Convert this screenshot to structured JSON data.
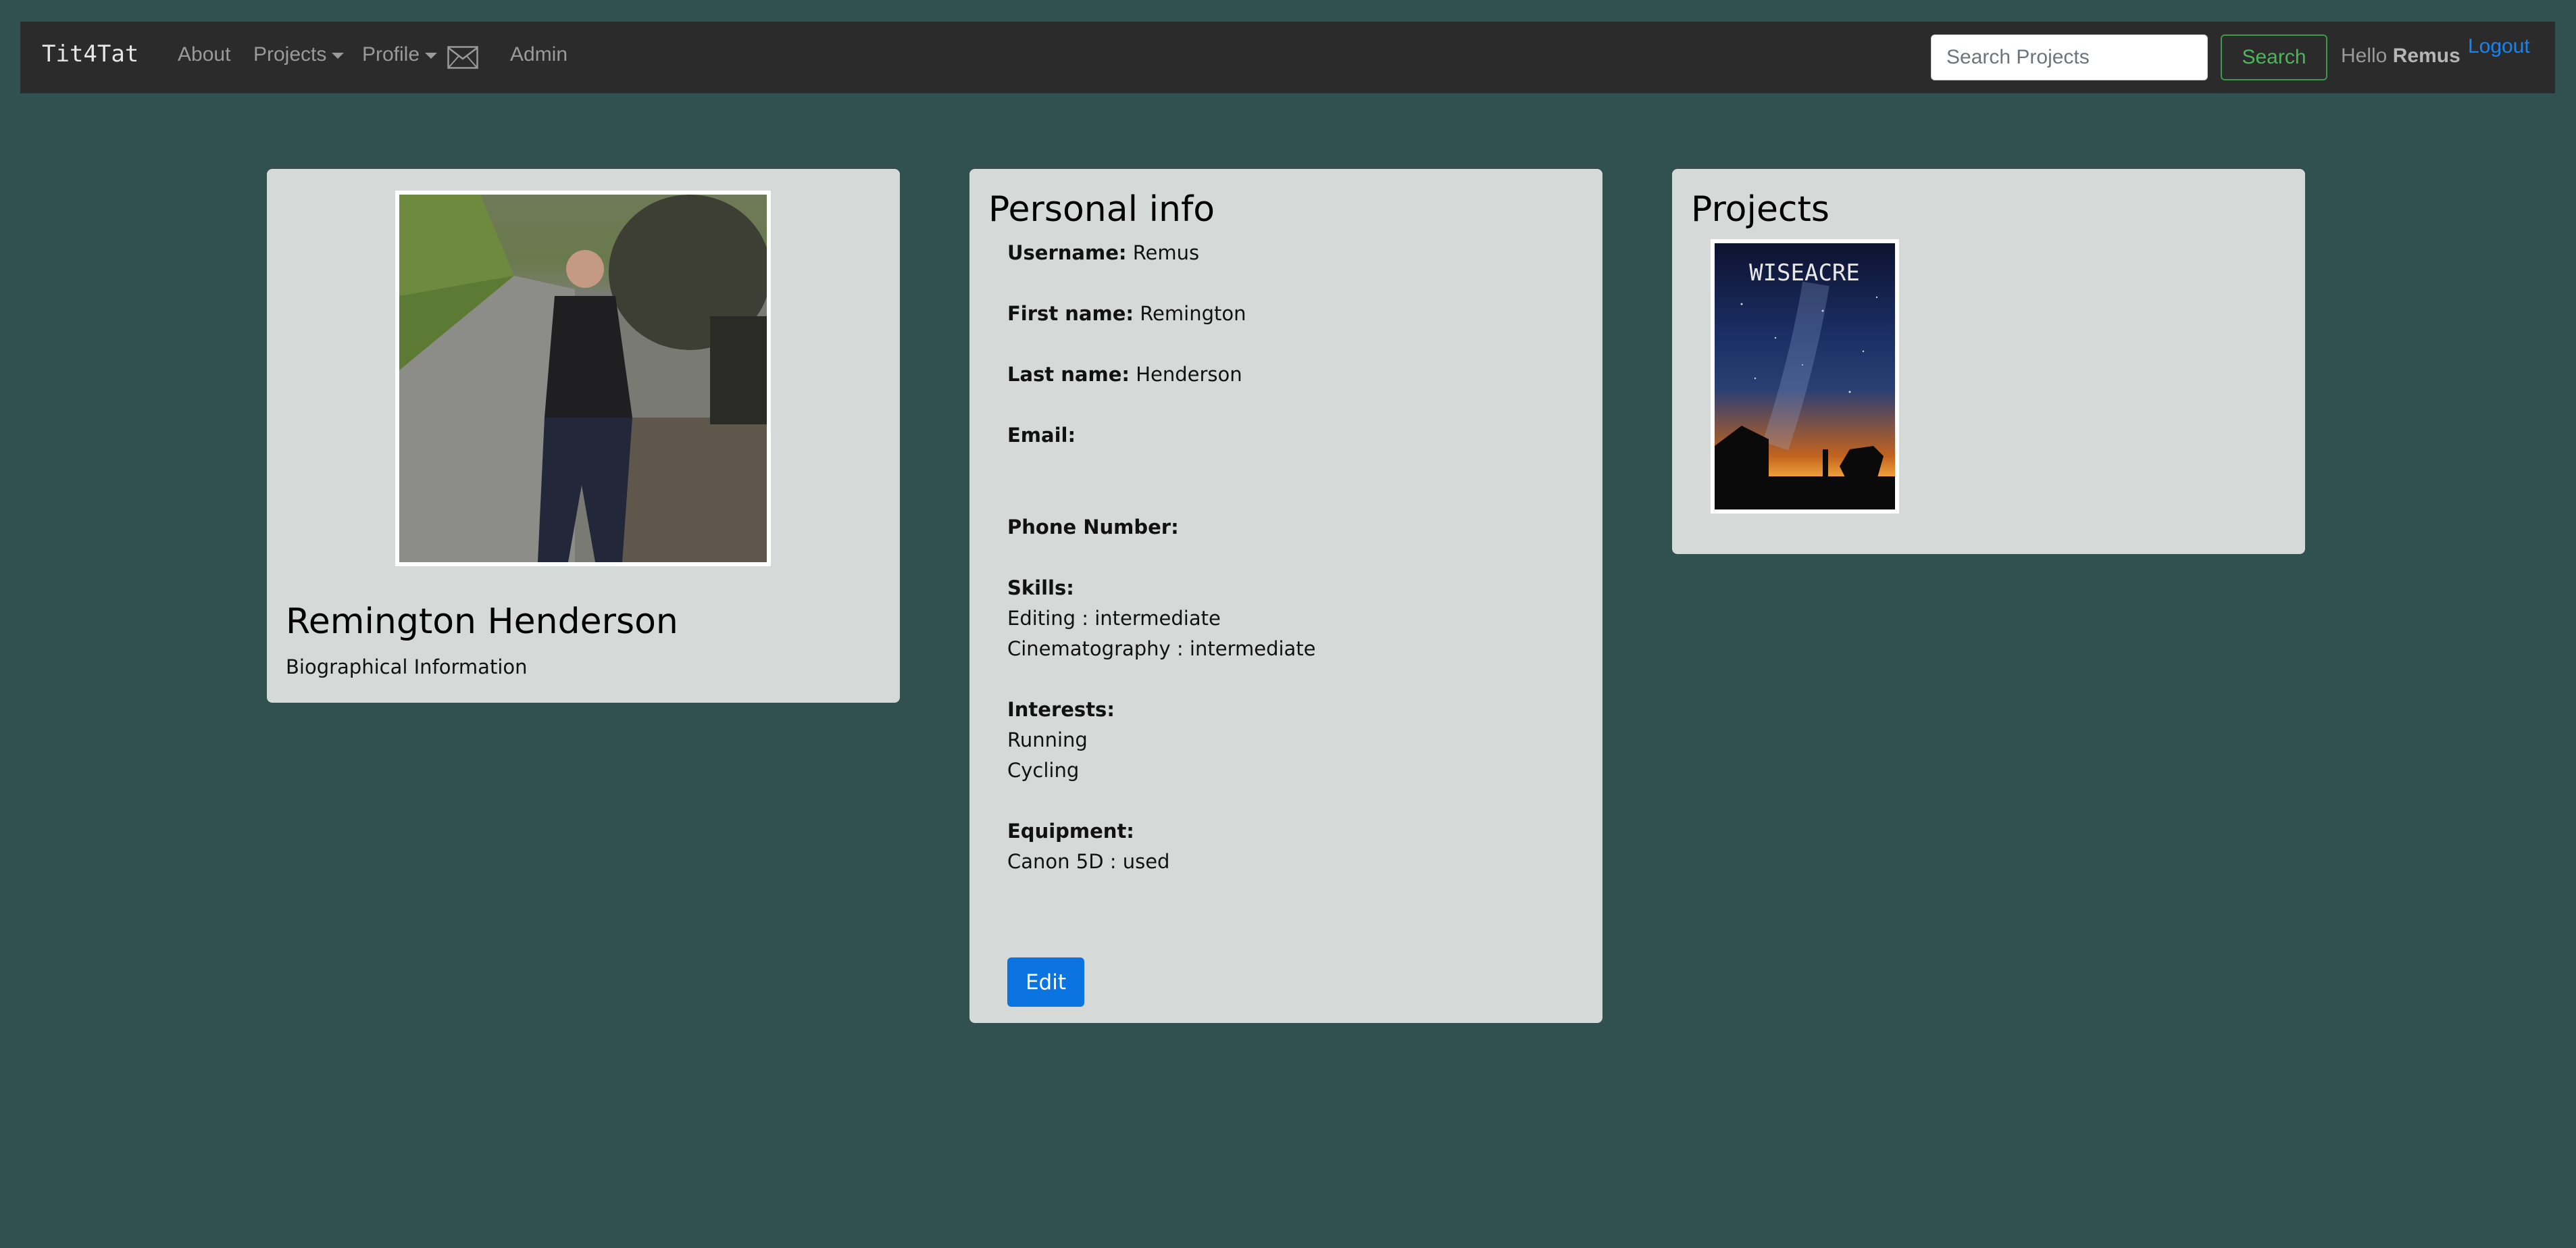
{
  "nav": {
    "brand": "Tit4Tat",
    "about": "About",
    "projects": "Projects",
    "profile": "Profile",
    "admin": "Admin",
    "search_placeholder": "Search Projects",
    "search_button": "Search",
    "hello": "Hello",
    "username": "Remus",
    "logout": "Logout"
  },
  "profile_card": {
    "name": "Remington Henderson",
    "bio": "Biographical Information"
  },
  "personal_info": {
    "title": "Personal info",
    "username_label": "Username:",
    "username_value": "Remus",
    "first_name_label": "First name:",
    "first_name_value": "Remington",
    "last_name_label": "Last name:",
    "last_name_value": "Henderson",
    "email_label": "Email:",
    "phone_label": "Phone Number:",
    "skills_label": "Skills:",
    "skills": [
      "Editing : intermediate",
      "Cinematography : intermediate"
    ],
    "interests_label": "Interests:",
    "interests": [
      "Running",
      "Cycling"
    ],
    "equipment_label": "Equipment:",
    "equipment": [
      "Canon 5D : used"
    ],
    "edit_button": "Edit"
  },
  "projects_card": {
    "title": "Projects",
    "poster_title": "WISEACRE"
  },
  "colors": {
    "background": "#315150",
    "navbar": "#2b2b2b",
    "card": "#d5dad9",
    "primary": "#0b74e0",
    "success": "#4fb55a",
    "link": "#1a84ee"
  }
}
